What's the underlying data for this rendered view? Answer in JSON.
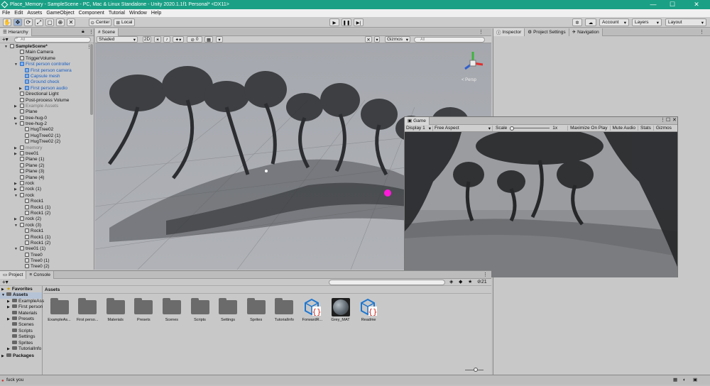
{
  "window": {
    "title": "Place_Memory - SampleScene - PC, Mac & Linux Standalone - Unity 2020.1.1f1 Personal* <DX11>",
    "min": "—",
    "max": "☐",
    "close": "✕"
  },
  "menu": [
    "File",
    "Edit",
    "Assets",
    "GameObject",
    "Component",
    "Tutorial",
    "Window",
    "Help"
  ],
  "toolbar": {
    "center": "Center",
    "local": "Local",
    "account": "Account",
    "layers": "Layers",
    "layout": "Layout"
  },
  "hierarchy": {
    "tab": "Hierarchy",
    "search_placeholder": "All",
    "rows": [
      {
        "label": "SampleScene*",
        "indent": 0,
        "arrow": "down",
        "style": "bold",
        "icon": "scene"
      },
      {
        "label": "Main Camera",
        "indent": 2,
        "arrow": "",
        "style": "",
        "icon": "cube"
      },
      {
        "label": "TriggerVolume",
        "indent": 2,
        "arrow": "",
        "style": "",
        "icon": "cube"
      },
      {
        "label": "First person controller",
        "indent": 2,
        "arrow": "down",
        "style": "blue",
        "icon": "cube"
      },
      {
        "label": "First person camera",
        "indent": 3,
        "arrow": "",
        "style": "blue",
        "icon": "cube"
      },
      {
        "label": "Capsule mesh",
        "indent": 3,
        "arrow": "",
        "style": "blue",
        "icon": "cube"
      },
      {
        "label": "Ground check",
        "indent": 3,
        "arrow": "",
        "style": "blue",
        "icon": "cube"
      },
      {
        "label": "First person audio",
        "indent": 3,
        "arrow": "right",
        "style": "blue",
        "icon": "cube"
      },
      {
        "label": "Directional Light",
        "indent": 2,
        "arrow": "",
        "style": "",
        "icon": "cube"
      },
      {
        "label": "Post-process Volume",
        "indent": 2,
        "arrow": "",
        "style": "",
        "icon": "cube"
      },
      {
        "label": "Example Assets",
        "indent": 2,
        "arrow": "right",
        "style": "gray",
        "icon": "cube"
      },
      {
        "label": "Plane",
        "indent": 2,
        "arrow": "",
        "style": "",
        "icon": "cube"
      },
      {
        "label": "tree-hug-0",
        "indent": 2,
        "arrow": "right",
        "style": "",
        "icon": "cube"
      },
      {
        "label": "tree-hug-2",
        "indent": 2,
        "arrow": "down",
        "style": "",
        "icon": "cube"
      },
      {
        "label": "HugTree02",
        "indent": 3,
        "arrow": "",
        "style": "",
        "icon": "cube"
      },
      {
        "label": "HugTree02 (1)",
        "indent": 3,
        "arrow": "",
        "style": "",
        "icon": "cube"
      },
      {
        "label": "HugTree02 (2)",
        "indent": 3,
        "arrow": "",
        "style": "",
        "icon": "cube"
      },
      {
        "label": "memory",
        "indent": 2,
        "arrow": "right",
        "style": "gray",
        "icon": "cube"
      },
      {
        "label": "tree01",
        "indent": 2,
        "arrow": "right",
        "style": "",
        "icon": "cube"
      },
      {
        "label": "Plane (1)",
        "indent": 2,
        "arrow": "",
        "style": "",
        "icon": "cube"
      },
      {
        "label": "Plane (2)",
        "indent": 2,
        "arrow": "",
        "style": "",
        "icon": "cube"
      },
      {
        "label": "Plane (3)",
        "indent": 2,
        "arrow": "",
        "style": "",
        "icon": "cube"
      },
      {
        "label": "Plane (4)",
        "indent": 2,
        "arrow": "",
        "style": "",
        "icon": "cube"
      },
      {
        "label": "rock",
        "indent": 2,
        "arrow": "right",
        "style": "",
        "icon": "cube"
      },
      {
        "label": "rock (1)",
        "indent": 2,
        "arrow": "right",
        "style": "",
        "icon": "cube"
      },
      {
        "label": "rock",
        "indent": 2,
        "arrow": "down",
        "style": "",
        "icon": "cube"
      },
      {
        "label": "Rock1",
        "indent": 3,
        "arrow": "",
        "style": "",
        "icon": "cube"
      },
      {
        "label": "Rock1 (1)",
        "indent": 3,
        "arrow": "",
        "style": "",
        "icon": "cube"
      },
      {
        "label": "Rock1 (2)",
        "indent": 3,
        "arrow": "",
        "style": "",
        "icon": "cube"
      },
      {
        "label": "rock (2)",
        "indent": 2,
        "arrow": "right",
        "style": "",
        "icon": "cube"
      },
      {
        "label": "rock (3)",
        "indent": 2,
        "arrow": "down",
        "style": "",
        "icon": "cube"
      },
      {
        "label": "Rock1",
        "indent": 3,
        "arrow": "",
        "style": "",
        "icon": "cube"
      },
      {
        "label": "Rock1 (1)",
        "indent": 3,
        "arrow": "",
        "style": "",
        "icon": "cube"
      },
      {
        "label": "Rock1 (2)",
        "indent": 3,
        "arrow": "",
        "style": "",
        "icon": "cube"
      },
      {
        "label": "tree01 (1)",
        "indent": 2,
        "arrow": "down",
        "style": "",
        "icon": "cube"
      },
      {
        "label": "Tree0",
        "indent": 3,
        "arrow": "",
        "style": "",
        "icon": "cube"
      },
      {
        "label": "Tree0 (1)",
        "indent": 3,
        "arrow": "",
        "style": "",
        "icon": "cube"
      },
      {
        "label": "Tree0 (2)",
        "indent": 3,
        "arrow": "",
        "style": "",
        "icon": "cube"
      }
    ]
  },
  "scene": {
    "tab": "Scene",
    "shading": "Shaded",
    "mode2d": "2D",
    "hidden_count": "0",
    "gizmos": "Gizmos",
    "search_placeholder": "All",
    "persp": "< Persp"
  },
  "inspector": {
    "tabs": [
      "Inspector",
      "Project Settings",
      "Navigation"
    ]
  },
  "game": {
    "tab": "Game",
    "display": "Display 1",
    "aspect": "Free Aspect",
    "scale_label": "Scale",
    "scale_value": "1x",
    "buttons": [
      "Maximize On Play",
      "Mute Audio",
      "Stats",
      "Gizmos"
    ]
  },
  "project": {
    "tabs": [
      "Project",
      "Console"
    ],
    "assets_title": "Assets",
    "count": "21",
    "tree": [
      {
        "label": "Favorites",
        "indent": 0,
        "arrow": "right",
        "style": "bold",
        "icon": "star"
      },
      {
        "label": "Assets",
        "indent": 0,
        "arrow": "down",
        "style": "bold",
        "icon": "folder"
      },
      {
        "label": "ExampleAss",
        "indent": 1,
        "arrow": "right",
        "style": "",
        "icon": "folder"
      },
      {
        "label": "First person",
        "indent": 1,
        "arrow": "right",
        "style": "",
        "icon": "folder"
      },
      {
        "label": "Materials",
        "indent": 1,
        "arrow": "",
        "style": "",
        "icon": "folder"
      },
      {
        "label": "Presets",
        "indent": 1,
        "arrow": "right",
        "style": "",
        "icon": "folder"
      },
      {
        "label": "Scenes",
        "indent": 1,
        "arrow": "",
        "style": "",
        "icon": "folder"
      },
      {
        "label": "Scripts",
        "indent": 1,
        "arrow": "",
        "style": "",
        "icon": "folder"
      },
      {
        "label": "Settings",
        "indent": 1,
        "arrow": "",
        "style": "",
        "icon": "folder"
      },
      {
        "label": "Sprites",
        "indent": 1,
        "arrow": "",
        "style": "",
        "icon": "folder"
      },
      {
        "label": "TutorialInfo",
        "indent": 1,
        "arrow": "right",
        "style": "",
        "icon": "folder"
      },
      {
        "label": "Packages",
        "indent": 0,
        "arrow": "right",
        "style": "bold",
        "icon": "folder"
      }
    ],
    "items": [
      {
        "label": "ExampleAs...",
        "kind": "folder"
      },
      {
        "label": "First perso...",
        "kind": "folder"
      },
      {
        "label": "Materials",
        "kind": "folder"
      },
      {
        "label": "Presets",
        "kind": "folder"
      },
      {
        "label": "Scenes",
        "kind": "folder"
      },
      {
        "label": "Scripts",
        "kind": "folder"
      },
      {
        "label": "Settings",
        "kind": "folder"
      },
      {
        "label": "Sprites",
        "kind": "folder"
      },
      {
        "label": "TutorialInfo",
        "kind": "folder"
      },
      {
        "label": "ForwardR...",
        "kind": "asset"
      },
      {
        "label": "Grey_MAT",
        "kind": "material"
      },
      {
        "label": "Readme",
        "kind": "asset"
      }
    ]
  },
  "status": {
    "message": "fuck you"
  },
  "colors": {
    "title_bg": "#1aa085",
    "link_blue": "#1d5fc0",
    "asset_blue": "#1f77d0",
    "asset_red": "#d02a1f"
  }
}
